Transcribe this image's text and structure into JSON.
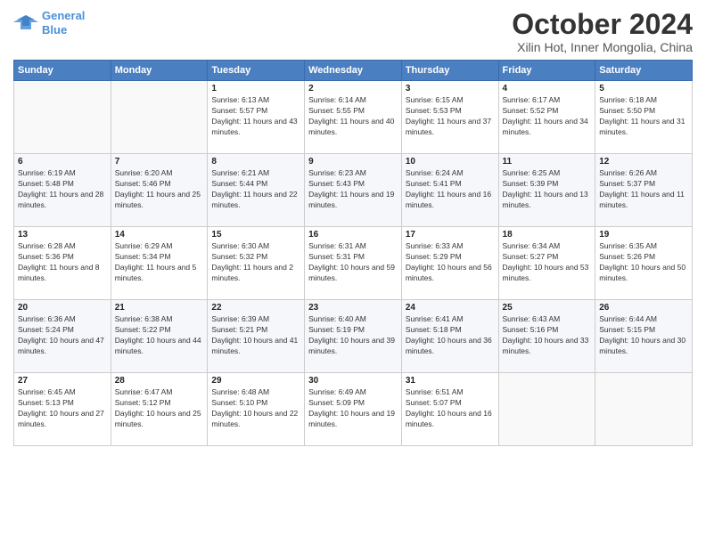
{
  "logo": {
    "line1": "General",
    "line2": "Blue"
  },
  "title": "October 2024",
  "location": "Xilin Hot, Inner Mongolia, China",
  "days_header": [
    "Sunday",
    "Monday",
    "Tuesday",
    "Wednesday",
    "Thursday",
    "Friday",
    "Saturday"
  ],
  "weeks": [
    [
      {
        "day": "",
        "sunrise": "",
        "sunset": "",
        "daylight": ""
      },
      {
        "day": "",
        "sunrise": "",
        "sunset": "",
        "daylight": ""
      },
      {
        "day": "1",
        "sunrise": "Sunrise: 6:13 AM",
        "sunset": "Sunset: 5:57 PM",
        "daylight": "Daylight: 11 hours and 43 minutes."
      },
      {
        "day": "2",
        "sunrise": "Sunrise: 6:14 AM",
        "sunset": "Sunset: 5:55 PM",
        "daylight": "Daylight: 11 hours and 40 minutes."
      },
      {
        "day": "3",
        "sunrise": "Sunrise: 6:15 AM",
        "sunset": "Sunset: 5:53 PM",
        "daylight": "Daylight: 11 hours and 37 minutes."
      },
      {
        "day": "4",
        "sunrise": "Sunrise: 6:17 AM",
        "sunset": "Sunset: 5:52 PM",
        "daylight": "Daylight: 11 hours and 34 minutes."
      },
      {
        "day": "5",
        "sunrise": "Sunrise: 6:18 AM",
        "sunset": "Sunset: 5:50 PM",
        "daylight": "Daylight: 11 hours and 31 minutes."
      }
    ],
    [
      {
        "day": "6",
        "sunrise": "Sunrise: 6:19 AM",
        "sunset": "Sunset: 5:48 PM",
        "daylight": "Daylight: 11 hours and 28 minutes."
      },
      {
        "day": "7",
        "sunrise": "Sunrise: 6:20 AM",
        "sunset": "Sunset: 5:46 PM",
        "daylight": "Daylight: 11 hours and 25 minutes."
      },
      {
        "day": "8",
        "sunrise": "Sunrise: 6:21 AM",
        "sunset": "Sunset: 5:44 PM",
        "daylight": "Daylight: 11 hours and 22 minutes."
      },
      {
        "day": "9",
        "sunrise": "Sunrise: 6:23 AM",
        "sunset": "Sunset: 5:43 PM",
        "daylight": "Daylight: 11 hours and 19 minutes."
      },
      {
        "day": "10",
        "sunrise": "Sunrise: 6:24 AM",
        "sunset": "Sunset: 5:41 PM",
        "daylight": "Daylight: 11 hours and 16 minutes."
      },
      {
        "day": "11",
        "sunrise": "Sunrise: 6:25 AM",
        "sunset": "Sunset: 5:39 PM",
        "daylight": "Daylight: 11 hours and 13 minutes."
      },
      {
        "day": "12",
        "sunrise": "Sunrise: 6:26 AM",
        "sunset": "Sunset: 5:37 PM",
        "daylight": "Daylight: 11 hours and 11 minutes."
      }
    ],
    [
      {
        "day": "13",
        "sunrise": "Sunrise: 6:28 AM",
        "sunset": "Sunset: 5:36 PM",
        "daylight": "Daylight: 11 hours and 8 minutes."
      },
      {
        "day": "14",
        "sunrise": "Sunrise: 6:29 AM",
        "sunset": "Sunset: 5:34 PM",
        "daylight": "Daylight: 11 hours and 5 minutes."
      },
      {
        "day": "15",
        "sunrise": "Sunrise: 6:30 AM",
        "sunset": "Sunset: 5:32 PM",
        "daylight": "Daylight: 11 hours and 2 minutes."
      },
      {
        "day": "16",
        "sunrise": "Sunrise: 6:31 AM",
        "sunset": "Sunset: 5:31 PM",
        "daylight": "Daylight: 10 hours and 59 minutes."
      },
      {
        "day": "17",
        "sunrise": "Sunrise: 6:33 AM",
        "sunset": "Sunset: 5:29 PM",
        "daylight": "Daylight: 10 hours and 56 minutes."
      },
      {
        "day": "18",
        "sunrise": "Sunrise: 6:34 AM",
        "sunset": "Sunset: 5:27 PM",
        "daylight": "Daylight: 10 hours and 53 minutes."
      },
      {
        "day": "19",
        "sunrise": "Sunrise: 6:35 AM",
        "sunset": "Sunset: 5:26 PM",
        "daylight": "Daylight: 10 hours and 50 minutes."
      }
    ],
    [
      {
        "day": "20",
        "sunrise": "Sunrise: 6:36 AM",
        "sunset": "Sunset: 5:24 PM",
        "daylight": "Daylight: 10 hours and 47 minutes."
      },
      {
        "day": "21",
        "sunrise": "Sunrise: 6:38 AM",
        "sunset": "Sunset: 5:22 PM",
        "daylight": "Daylight: 10 hours and 44 minutes."
      },
      {
        "day": "22",
        "sunrise": "Sunrise: 6:39 AM",
        "sunset": "Sunset: 5:21 PM",
        "daylight": "Daylight: 10 hours and 41 minutes."
      },
      {
        "day": "23",
        "sunrise": "Sunrise: 6:40 AM",
        "sunset": "Sunset: 5:19 PM",
        "daylight": "Daylight: 10 hours and 39 minutes."
      },
      {
        "day": "24",
        "sunrise": "Sunrise: 6:41 AM",
        "sunset": "Sunset: 5:18 PM",
        "daylight": "Daylight: 10 hours and 36 minutes."
      },
      {
        "day": "25",
        "sunrise": "Sunrise: 6:43 AM",
        "sunset": "Sunset: 5:16 PM",
        "daylight": "Daylight: 10 hours and 33 minutes."
      },
      {
        "day": "26",
        "sunrise": "Sunrise: 6:44 AM",
        "sunset": "Sunset: 5:15 PM",
        "daylight": "Daylight: 10 hours and 30 minutes."
      }
    ],
    [
      {
        "day": "27",
        "sunrise": "Sunrise: 6:45 AM",
        "sunset": "Sunset: 5:13 PM",
        "daylight": "Daylight: 10 hours and 27 minutes."
      },
      {
        "day": "28",
        "sunrise": "Sunrise: 6:47 AM",
        "sunset": "Sunset: 5:12 PM",
        "daylight": "Daylight: 10 hours and 25 minutes."
      },
      {
        "day": "29",
        "sunrise": "Sunrise: 6:48 AM",
        "sunset": "Sunset: 5:10 PM",
        "daylight": "Daylight: 10 hours and 22 minutes."
      },
      {
        "day": "30",
        "sunrise": "Sunrise: 6:49 AM",
        "sunset": "Sunset: 5:09 PM",
        "daylight": "Daylight: 10 hours and 19 minutes."
      },
      {
        "day": "31",
        "sunrise": "Sunrise: 6:51 AM",
        "sunset": "Sunset: 5:07 PM",
        "daylight": "Daylight: 10 hours and 16 minutes."
      },
      {
        "day": "",
        "sunrise": "",
        "sunset": "",
        "daylight": ""
      },
      {
        "day": "",
        "sunrise": "",
        "sunset": "",
        "daylight": ""
      }
    ]
  ]
}
